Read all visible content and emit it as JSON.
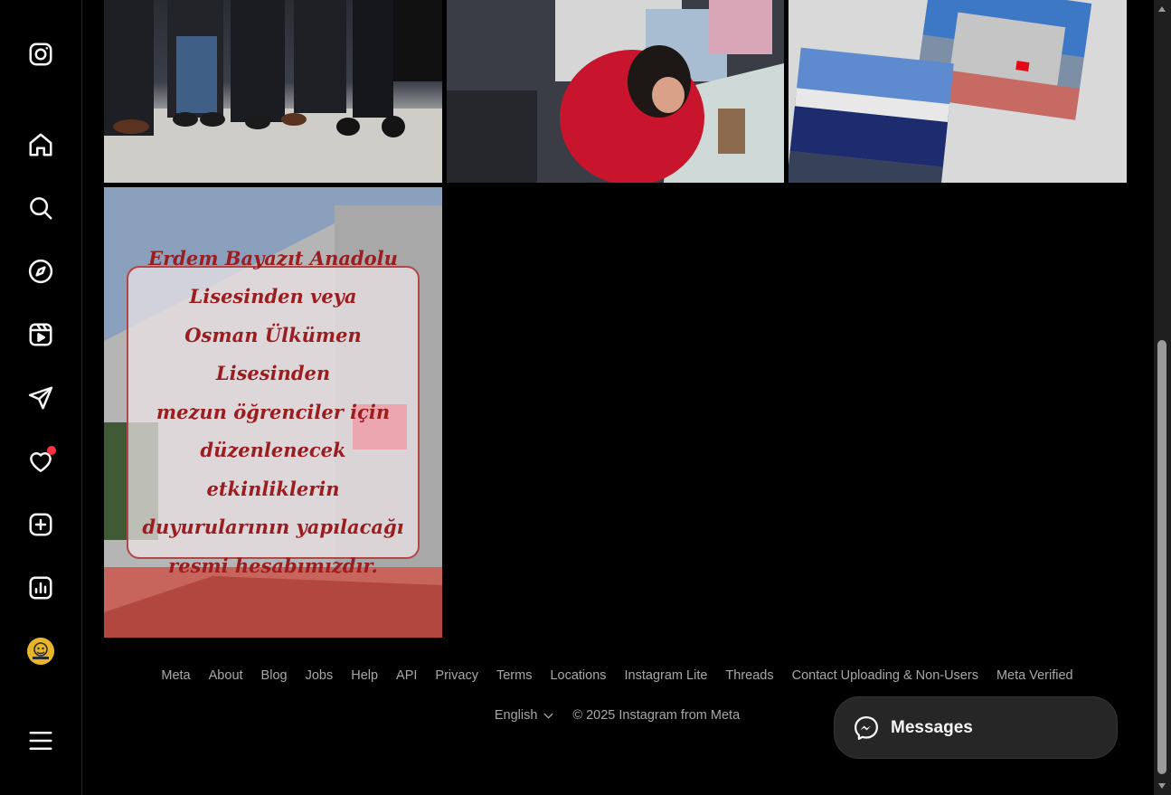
{
  "sidebar": {
    "icons": [
      "instagram-icon",
      "home-icon",
      "search-icon",
      "explore-icon",
      "reels-icon",
      "messages-icon",
      "heart-icon",
      "create-icon",
      "insights-icon"
    ],
    "has_notification": true,
    "notification_color": "#ff3040",
    "more_icon": "menu-icon"
  },
  "posts": {
    "announcement": {
      "text": "Erdem Bayazıt Anadolu\nLisesinden veya\nOsman Ülkümen Lisesinden\nmezun öğrenciler için\ndüzenlenecek etkinliklerin\nduyurularının yapılacağı\nresmi hesabımızdır."
    }
  },
  "footer": {
    "links": [
      "Meta",
      "About",
      "Blog",
      "Jobs",
      "Help",
      "API",
      "Privacy",
      "Terms",
      "Locations",
      "Instagram Lite",
      "Threads",
      "Contact Uploading & Non-Users",
      "Meta Verified"
    ],
    "language": "English",
    "copyright": "© 2025 Instagram from Meta"
  },
  "messages_button": {
    "label": "Messages"
  },
  "colors": {
    "background": "#000000",
    "text_secondary": "#a8a8a8",
    "announcement_text": "#9b1d20",
    "notification": "#ff3040"
  }
}
